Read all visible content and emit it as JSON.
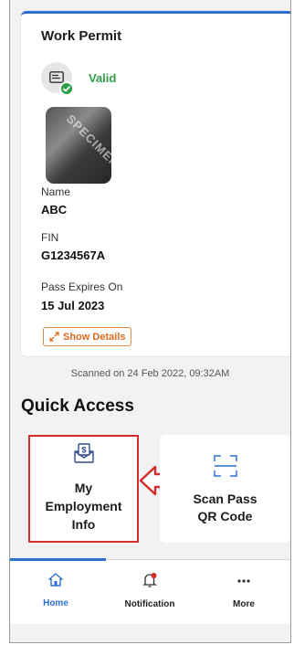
{
  "permit": {
    "title": "Work Permit",
    "status": "Valid",
    "photo_watermark": "SPECIMEN",
    "name_label": "Name",
    "name_value": "ABC",
    "fin_label": "FIN",
    "fin_value": "G1234567A",
    "expiry_label": "Pass Expires On",
    "expiry_value": "15 Jul 2023",
    "show_details_label": "Show Details"
  },
  "scanned_text": "Scanned on 24 Feb 2022, 09:32AM",
  "quick_access": {
    "title": "Quick Access",
    "tiles": [
      {
        "line1": "My",
        "line2": "Employment",
        "line3": "Info",
        "icon": "envelope-dollar-icon"
      },
      {
        "line1": "Scan Pass",
        "line2": "QR Code",
        "icon": "qr-scan-icon"
      }
    ]
  },
  "tabs": [
    {
      "label": "Home",
      "icon": "home-icon",
      "active": true
    },
    {
      "label": "Notification",
      "icon": "bell-icon",
      "active": false
    },
    {
      "label": "More",
      "icon": "more-icon",
      "active": false
    }
  ],
  "colors": {
    "accent": "#2d6fd0",
    "valid": "#2e9e48",
    "highlight": "#d62b2b",
    "details": "#d96b1e"
  }
}
